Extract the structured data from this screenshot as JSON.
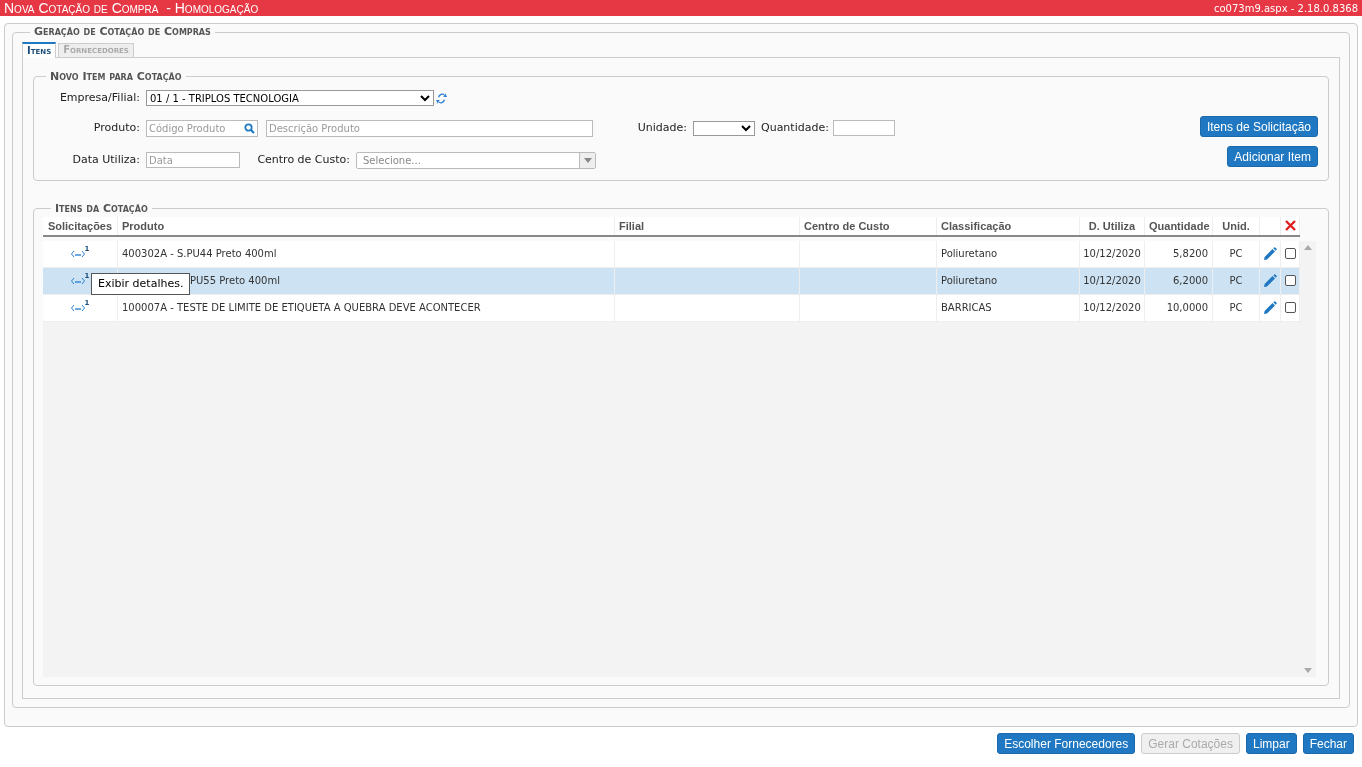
{
  "header": {
    "title": "Nova Cotação de Compra  - Homologação",
    "version": "co073m9.aspx - 2.18.0.8368"
  },
  "main_legend": "Geração de Cotação de Compras",
  "tabs": [
    {
      "label": "Itens",
      "selected": true
    },
    {
      "label": "Fornecedores",
      "selected": false
    }
  ],
  "new_item": {
    "legend": "Novo Item para Cotação",
    "empresa": {
      "label": "Empresa/Filial:",
      "value": "01 / 1 - TRIPLOS TECNOLOGIA"
    },
    "produto": {
      "label": "Produto:",
      "code_placeholder": "Código Produto",
      "desc_placeholder": "Descrição Produto"
    },
    "unidade": {
      "label": "Unidade:"
    },
    "quantidade": {
      "label": "Quantidade:"
    },
    "data": {
      "label": "Data Utiliza:",
      "placeholder": "Data"
    },
    "centro": {
      "label": "Centro de Custo:",
      "placeholder": "Selecione..."
    },
    "buttons": [
      "Itens de Solicitação",
      "Adicionar Item"
    ]
  },
  "items": {
    "legend": "Itens da Cotação",
    "columns": [
      "Solicitações",
      "Produto",
      "Filial",
      "Centro de Custo",
      "Classificação",
      "D. Utiliza",
      "Quantidade",
      "Unid."
    ],
    "rows": [
      {
        "count": "1",
        "product": "400302A - S.PU44 Preto 400ml",
        "classification": "Poliuretano",
        "date": "10/12/2020",
        "quantity": "5,8200",
        "unit": "PC",
        "selected": false,
        "checked": false
      },
      {
        "count": "1",
        "product": "PU55 Preto 400ml",
        "tooltip": "Exibir detalhes.",
        "classification": "Poliuretano",
        "date": "10/12/2020",
        "quantity": "6,2000",
        "unit": "PC",
        "selected": true,
        "checked": false
      },
      {
        "count": "1",
        "product": "100007A - TESTE DE LIMITE DE ETIQUETA A QUEBRA DEVE ACONTECER",
        "classification": "BARRICAS",
        "date": "10/12/2020",
        "quantity": "10,0000",
        "unit": "PC",
        "selected": false,
        "checked": false
      }
    ]
  },
  "footer_buttons": [
    {
      "label": "Escolher Fornecedores",
      "disabled": false
    },
    {
      "label": "Gerar Cotações",
      "disabled": true
    },
    {
      "label": "Limpar",
      "disabled": false
    },
    {
      "label": "Fechar",
      "disabled": false
    }
  ]
}
